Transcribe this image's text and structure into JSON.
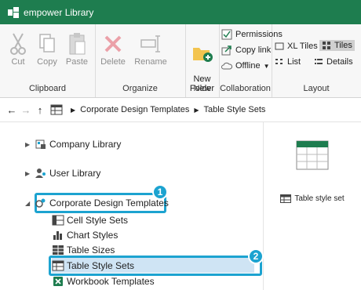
{
  "window": {
    "title": "empower Library"
  },
  "ribbon": {
    "clipboard": {
      "cut": "Cut",
      "copy": "Copy",
      "paste": "Paste",
      "label": "Clipboard"
    },
    "organize": {
      "delete": "Delete",
      "rename": "Rename",
      "label": "Organize"
    },
    "new": {
      "new_folder": "New\nFolder",
      "label": "New"
    },
    "collaboration": {
      "permissions": "Permissions",
      "copy_link": "Copy link",
      "offline": "Offline",
      "label": "Collaboration"
    },
    "layout": {
      "xl_tiles": "XL Tiles",
      "tiles": "Tiles",
      "list": "List",
      "details": "Details",
      "label": "Layout"
    }
  },
  "address": {
    "segments": [
      "Corporate Design Templates",
      "Table Style Sets"
    ]
  },
  "tree": {
    "company": "Company Library",
    "user": "User Library",
    "corporate": "Corporate Design Templates",
    "children": [
      "Cell Style Sets",
      "Chart Styles",
      "Table Sizes",
      "Table Style Sets",
      "Workbook Templates"
    ]
  },
  "callouts": [
    "1",
    "2"
  ],
  "content": {
    "item": "Table style set"
  }
}
